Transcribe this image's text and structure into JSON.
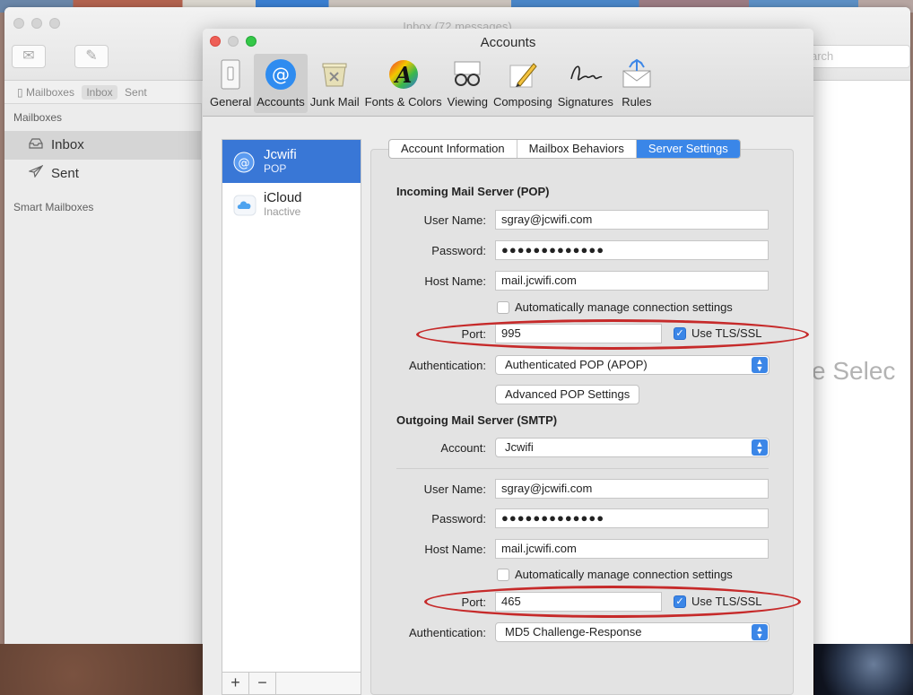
{
  "mail_window": {
    "title": "Inbox (72 messages)",
    "search_placeholder": "arch",
    "favorites": {
      "mailboxes": "Mailboxes",
      "inbox": "Inbox",
      "sent": "Sent"
    },
    "sidebar": {
      "heading": "Mailboxes",
      "items": [
        {
          "label": "Inbox",
          "icon": "inbox-tray-icon"
        },
        {
          "label": "Sent",
          "icon": "paper-plane-icon"
        }
      ],
      "smart_heading": "Smart Mailboxes"
    },
    "empty_message": "e Selec"
  },
  "prefs": {
    "title": "Accounts",
    "toolbar": [
      {
        "label": "General",
        "icon": "switch-icon"
      },
      {
        "label": "Accounts",
        "icon": "at-sign-icon"
      },
      {
        "label": "Junk Mail",
        "icon": "trash-bin-icon"
      },
      {
        "label": "Fonts & Colors",
        "icon": "font-a-icon"
      },
      {
        "label": "Viewing",
        "icon": "glasses-icon"
      },
      {
        "label": "Composing",
        "icon": "pencil-icon"
      },
      {
        "label": "Signatures",
        "icon": "signature-icon"
      },
      {
        "label": "Rules",
        "icon": "rules-envelope-icon"
      }
    ],
    "accounts": [
      {
        "name": "Jcwifi",
        "type": "POP",
        "icon": "at-sign-icon"
      },
      {
        "name": "iCloud",
        "type": "Inactive",
        "icon": "cloud-icon"
      }
    ],
    "list_actions": {
      "add": "+",
      "remove": "−"
    },
    "tabs": [
      "Account Information",
      "Mailbox Behaviors",
      "Server Settings"
    ],
    "incoming": {
      "heading": "Incoming Mail Server (POP)",
      "user_label": "User Name:",
      "user_value": "sgray@jcwifi.com",
      "password_label": "Password:",
      "password_value": "●●●●●●●●●●●●●",
      "host_label": "Host Name:",
      "host_value": "mail.jcwifi.com",
      "auto_label": "Automatically manage connection settings",
      "port_label": "Port:",
      "port_value": "995",
      "tls_label": "Use TLS/SSL",
      "auth_label": "Authentication:",
      "auth_value": "Authenticated POP (APOP)",
      "advanced_button": "Advanced POP Settings"
    },
    "outgoing": {
      "heading": "Outgoing Mail Server (SMTP)",
      "account_label": "Account:",
      "account_value": "Jcwifi",
      "user_label": "User Name:",
      "user_value": "sgray@jcwifi.com",
      "password_label": "Password:",
      "password_value": "●●●●●●●●●●●●●",
      "host_label": "Host Name:",
      "host_value": "mail.jcwifi.com",
      "auto_label": "Automatically manage connection settings",
      "port_label": "Port:",
      "port_value": "465",
      "tls_label": "Use TLS/SSL",
      "auth_label": "Authentication:",
      "auth_value": "MD5 Challenge-Response"
    },
    "colors": {
      "accent": "#3977d6",
      "highlight_ring": "#c62a2a"
    }
  }
}
